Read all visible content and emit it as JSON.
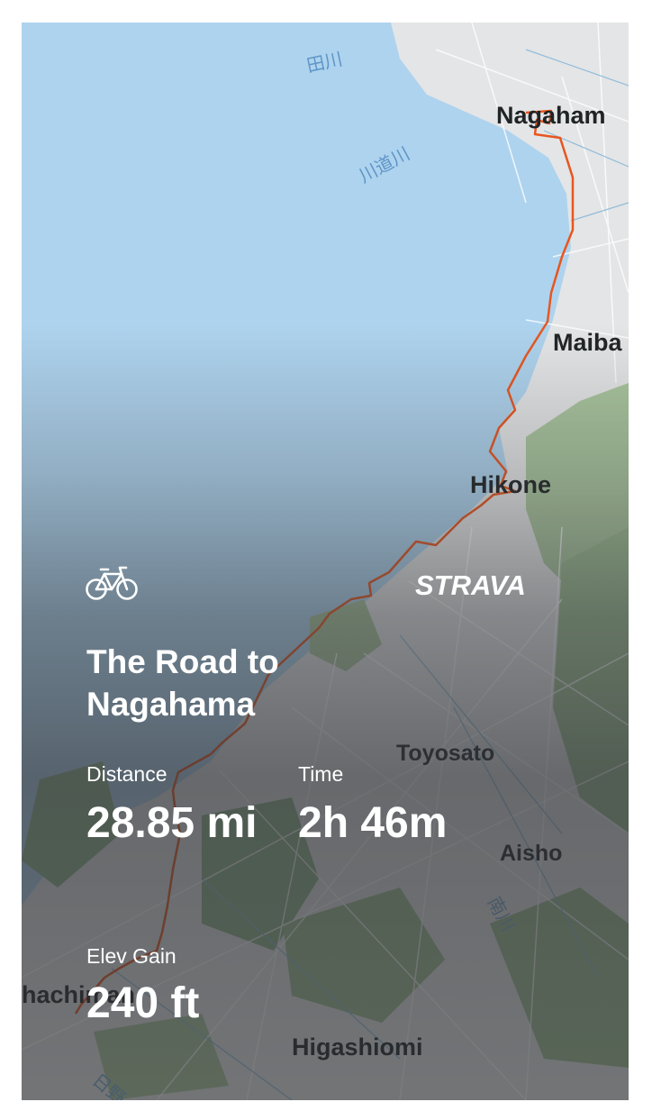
{
  "map": {
    "water_labels": [
      "田川",
      "川道川",
      "南川",
      "日野"
    ],
    "place_labels": [
      "Nagaham",
      "Maiba",
      "Hikone",
      "Toyosato",
      "Aisho",
      "Higashiomi",
      "hachiman"
    ]
  },
  "activity": {
    "type_icon": "bicycle-icon",
    "brand": "STRAVA",
    "title": "The Road to Nagahama",
    "stats": {
      "distance_label": "Distance",
      "distance_value": "28.85 mi",
      "time_label": "Time",
      "time_value": "2h 46m",
      "elev_label": "Elev Gain",
      "elev_value": "240 ft"
    }
  },
  "colors": {
    "route": "#e8561f",
    "water": "#aed3ee",
    "land": "#e4e5e6",
    "forest": "#8fb38a",
    "text": "#ffffff"
  }
}
